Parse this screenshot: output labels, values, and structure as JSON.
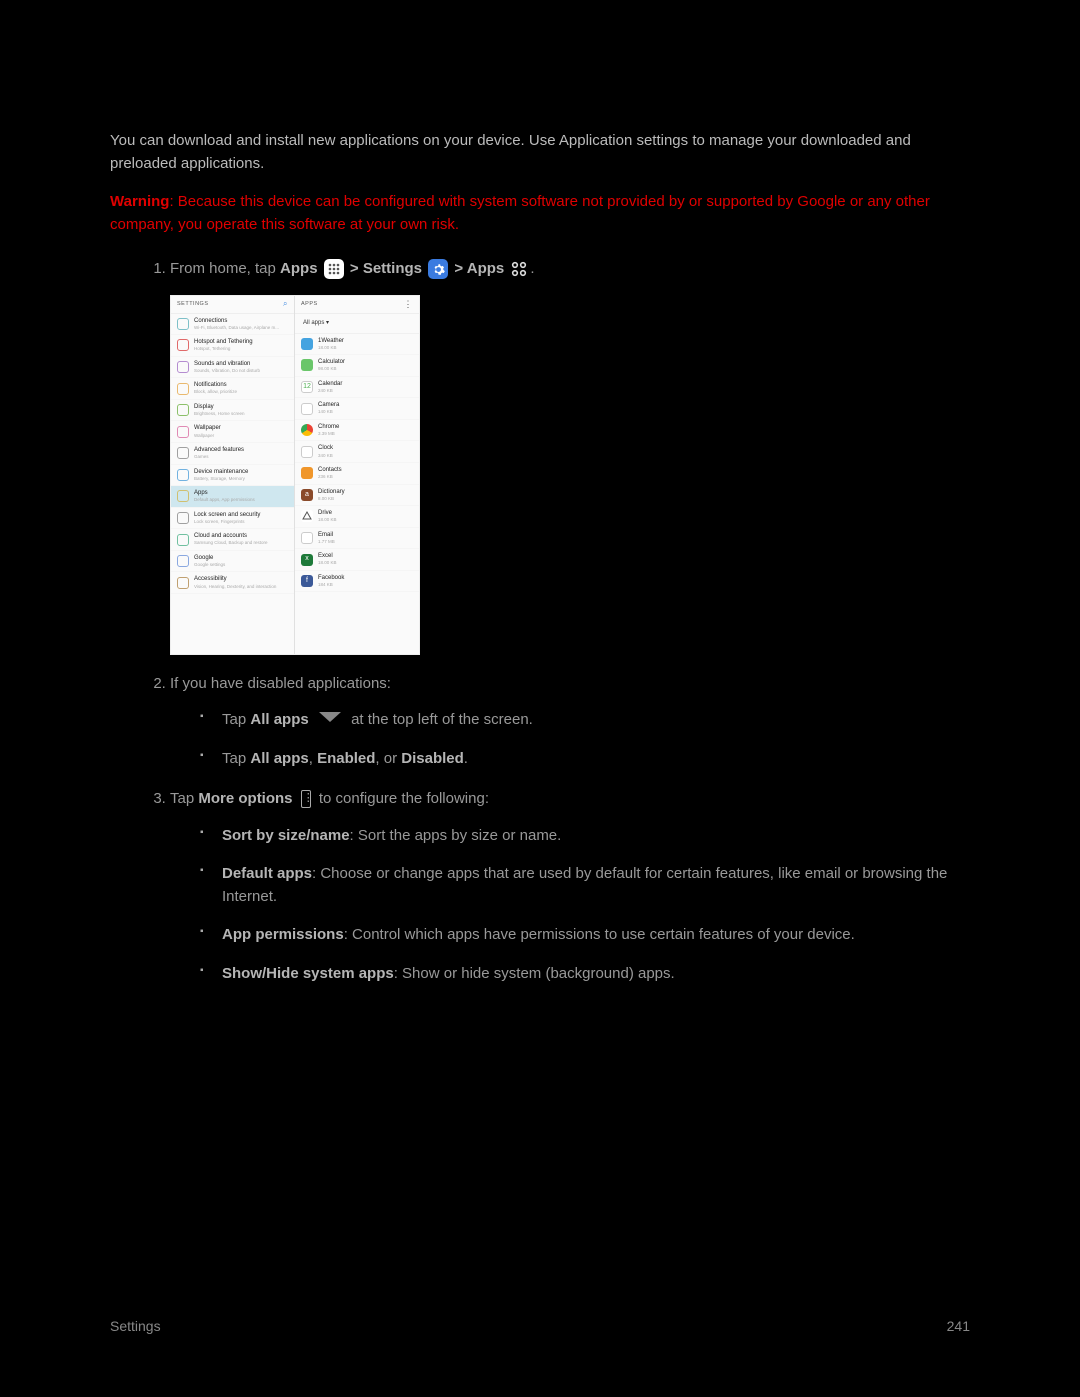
{
  "intro": "You can download and install new applications on your device. Use Application settings to manage your downloaded and preloaded applications.",
  "warning": {
    "label": "Warning",
    "text": ": Because this device can be configured with system software not provided by or supported by Google or any other company, you operate this software at your own risk."
  },
  "step1": {
    "pre": "From home, tap ",
    "apps": "Apps",
    "gt1": " > ",
    "settings": "Settings",
    "gt2": " > ",
    "apps2": "Apps",
    "end": "."
  },
  "screenshot": {
    "left_header": "SETTINGS",
    "right_header": "APPS",
    "all_apps": "All apps ▾",
    "left": [
      {
        "t": "Connections",
        "d": "Wi-Fi, Bluetooth, Data usage, Airplane m...",
        "c": "#7ec0c8"
      },
      {
        "t": "Hotspot and Tethering",
        "d": "Hotspot, Tethering",
        "c": "#e06a6a"
      },
      {
        "t": "Sounds and vibration",
        "d": "Sounds, Vibration, Do not disturb",
        "c": "#b48cd0"
      },
      {
        "t": "Notifications",
        "d": "Block, allow, prioritize",
        "c": "#e9b96e"
      },
      {
        "t": "Display",
        "d": "Brightness, Home screen",
        "c": "#8cc06a"
      },
      {
        "t": "Wallpaper",
        "d": "Wallpaper",
        "c": "#e08ab4"
      },
      {
        "t": "Advanced features",
        "d": "Games",
        "c": "#a0a0a0"
      },
      {
        "t": "Device maintenance",
        "d": "Battery, Storage, Memory",
        "c": "#72b2e0"
      },
      {
        "t": "Apps",
        "d": "Default apps, App permissions",
        "c": "#d0c070",
        "sel": true
      },
      {
        "t": "Lock screen and security",
        "d": "Lock screen, Fingerprints",
        "c": "#a0a0a0"
      },
      {
        "t": "Cloud and accounts",
        "d": "Samsung Cloud, Backup and restore",
        "c": "#70c0a0"
      },
      {
        "t": "Google",
        "d": "Google settings",
        "c": "#8aa8e0"
      },
      {
        "t": "Accessibility",
        "d": "Vision, Hearing, Dexterity, and interaction",
        "c": "#c0a070"
      }
    ],
    "right": [
      {
        "t": "1Weather",
        "d": "18.00 KB",
        "c": "#44a3e0"
      },
      {
        "t": "Calculator",
        "d": "98.00 KB",
        "c": "#6ac66a"
      },
      {
        "t": "Calendar",
        "d": "240 KB",
        "c": "#ffffff",
        "fg": "#4caf50",
        "txt": "12",
        "outline": true
      },
      {
        "t": "Camera",
        "d": "140 KB",
        "c": "#ffffff",
        "outline": true
      },
      {
        "t": "Chrome",
        "d": "3.39 MB",
        "c": "#ffffff",
        "grad": true
      },
      {
        "t": "Clock",
        "d": "340 KB",
        "c": "#ffffff",
        "outline": true
      },
      {
        "t": "Contacts",
        "d": "236 KB",
        "c": "#f0962a"
      },
      {
        "t": "Dictionary",
        "d": "8.00 KB",
        "c": "#8a4a2a",
        "txt": "a"
      },
      {
        "t": "Drive",
        "d": "18.00 KB",
        "c": "#ffffff",
        "tri": true
      },
      {
        "t": "Email",
        "d": "1.77 MB",
        "c": "#ffffff",
        "outline": true
      },
      {
        "t": "Excel",
        "d": "18.00 KB",
        "c": "#1e7a3a",
        "txt": "x"
      },
      {
        "t": "Facebook",
        "d": "184 KB",
        "c": "#3b5998",
        "txt": "f"
      }
    ]
  },
  "step2": {
    "intro": "If you have disabled applications:",
    "a_pre": "Tap ",
    "a_bold": "All apps",
    "a_post": " at the top left of the screen.",
    "b_pre": "Tap ",
    "b_allapps": "All apps",
    "b_sep1": ", ",
    "b_enabled": "Enabled",
    "b_sep2": ", or ",
    "b_disabled": "Disabled",
    "b_end": "."
  },
  "step3": {
    "pre": "Tap ",
    "more": "More options",
    "post": " to configure the following:",
    "items": [
      {
        "bold": "Sort by size/name",
        "text": ": Sort the apps by size or name."
      },
      {
        "bold": "Default apps",
        "text": ": Choose or change apps that are used by default for certain features, like email or browsing the Internet."
      },
      {
        "bold": "App permissions",
        "text": ": Control which apps have permissions to use certain features of your device."
      },
      {
        "bold": "Show/Hide system apps",
        "text": ": Show or hide system (background) apps."
      }
    ]
  },
  "footer": {
    "section": "Settings",
    "page": "241"
  }
}
